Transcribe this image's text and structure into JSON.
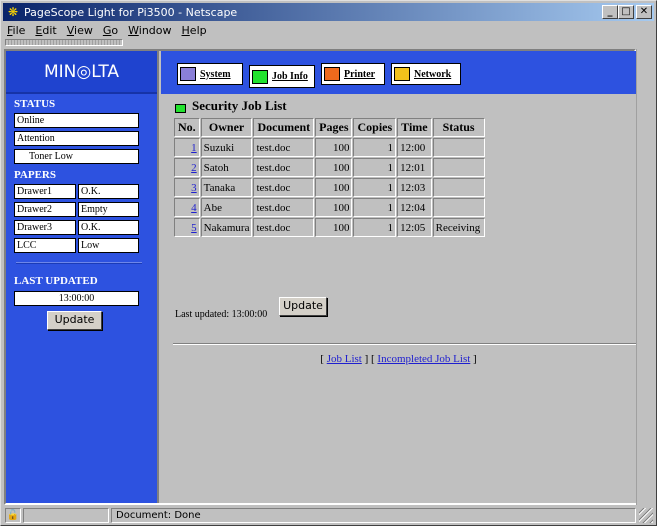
{
  "window": {
    "title": "PageScope Light for Pi3500 - Netscape",
    "icon": "netscape-icon"
  },
  "menu": [
    {
      "pre": "",
      "key": "F",
      "post": "ile"
    },
    {
      "pre": "",
      "key": "E",
      "post": "dit"
    },
    {
      "pre": "",
      "key": "V",
      "post": "iew"
    },
    {
      "pre": "",
      "key": "G",
      "post": "o"
    },
    {
      "pre": "",
      "key": "W",
      "post": "indow"
    },
    {
      "pre": "",
      "key": "H",
      "post": "elp"
    }
  ],
  "left": {
    "logo": "MIN◎LTA",
    "status_title": "STATUS",
    "status": [
      "Online",
      "Attention",
      "Toner Low"
    ],
    "papers_title": "PAPERS",
    "papers": [
      {
        "name": "Drawer1",
        "value": "O.K."
      },
      {
        "name": "Drawer2",
        "value": "Empty"
      },
      {
        "name": "Drawer3",
        "value": "O.K."
      },
      {
        "name": "LCC",
        "value": "Low"
      }
    ],
    "last_updated_title": "LAST UPDATED",
    "last_updated_value": "13:00:00",
    "update_label": "Update"
  },
  "tabs": [
    {
      "label": "System",
      "color": "#8a7fd8"
    },
    {
      "label": "Job Info",
      "color": "#22e22e"
    },
    {
      "label": "Printer",
      "color": "#ef6a1d"
    },
    {
      "label": "Network",
      "color": "#f2c21b"
    }
  ],
  "main": {
    "title": "Security Job List",
    "columns": [
      "No.",
      "Owner",
      "Document",
      "Pages",
      "Copies",
      "Time",
      "Status"
    ],
    "rows": [
      {
        "no": "1",
        "owner": "Suzuki",
        "document": "test.doc",
        "pages": "100",
        "copies": "1",
        "time": "12:00",
        "status": ""
      },
      {
        "no": "2",
        "owner": "Satoh",
        "document": "test.doc",
        "pages": "100",
        "copies": "1",
        "time": "12:01",
        "status": ""
      },
      {
        "no": "3",
        "owner": "Tanaka",
        "document": "test.doc",
        "pages": "100",
        "copies": "1",
        "time": "12:03",
        "status": ""
      },
      {
        "no": "4",
        "owner": "Abe",
        "document": "test.doc",
        "pages": "100",
        "copies": "1",
        "time": "12:04",
        "status": ""
      },
      {
        "no": "5",
        "owner": "Nakamura",
        "document": "test.doc",
        "pages": "100",
        "copies": "1",
        "time": "12:05",
        "status": "Receiving"
      }
    ],
    "last_updated": "Last updated: 13:00:00",
    "update_label": "Update",
    "link_job_list": "Job List",
    "link_incompleted": "Incompleted Job List"
  },
  "statusbar": {
    "text": "Document: Done"
  }
}
